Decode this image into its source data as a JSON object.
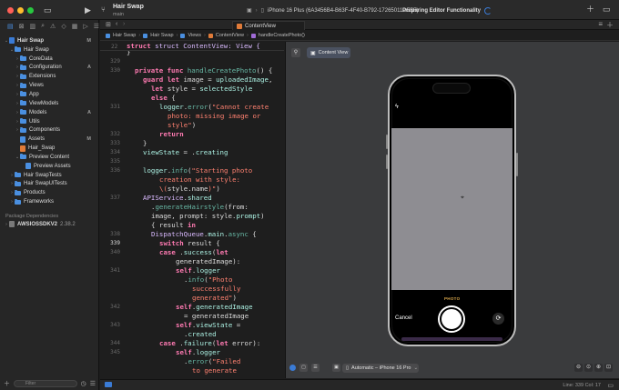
{
  "titlebar": {
    "project_name": "Hair Swap",
    "branch": "main",
    "device": "iPhone 16 Plus (6A3456B4-B63F-4F40-B792-17265011DE5F)",
    "status": "Preparing Editor Functionality",
    "colors": {
      "close": "#ff5f57",
      "minimize": "#febc2e",
      "zoom": "#28c840"
    }
  },
  "sidebar": {
    "items": [
      {
        "label": "Hair Swap",
        "badge": "M",
        "level": 0,
        "icon": "project-icon"
      },
      {
        "label": "Hair Swap",
        "badge": "",
        "level": 1,
        "icon": "folder-icon"
      },
      {
        "label": "CoreData",
        "badge": "",
        "level": 2,
        "icon": "folder-icon"
      },
      {
        "label": "Configuration",
        "badge": "A",
        "level": 2,
        "icon": "folder-icon"
      },
      {
        "label": "Extensions",
        "badge": "",
        "level": 2,
        "icon": "folder-icon"
      },
      {
        "label": "Views",
        "badge": "",
        "level": 2,
        "icon": "folder-icon"
      },
      {
        "label": "App",
        "badge": "",
        "level": 2,
        "icon": "folder-icon"
      },
      {
        "label": "ViewModels",
        "badge": "",
        "level": 2,
        "icon": "folder-icon"
      },
      {
        "label": "Models",
        "badge": "A",
        "level": 2,
        "icon": "folder-icon"
      },
      {
        "label": "Utils",
        "badge": "",
        "level": 2,
        "icon": "folder-icon"
      },
      {
        "label": "Components",
        "badge": "",
        "level": 2,
        "icon": "folder-icon"
      },
      {
        "label": "Assets",
        "badge": "M",
        "level": 2,
        "icon": "asset-icon"
      },
      {
        "label": "Hair_Swap",
        "badge": "",
        "level": 2,
        "icon": "swift-file-icon"
      },
      {
        "label": "Preview Content",
        "badge": "",
        "level": 2,
        "icon": "folder-icon"
      },
      {
        "label": "Preview Assets",
        "badge": "",
        "level": 3,
        "icon": "asset-icon"
      },
      {
        "label": "Hair SwapTests",
        "badge": "",
        "level": 1,
        "icon": "folder-icon"
      },
      {
        "label": "Hair SwapUITests",
        "badge": "",
        "level": 1,
        "icon": "folder-icon"
      },
      {
        "label": "Products",
        "badge": "",
        "level": 1,
        "icon": "folder-icon"
      },
      {
        "label": "Frameworks",
        "badge": "",
        "level": 1,
        "icon": "folder-icon"
      }
    ],
    "package_section": "Package Dependencies",
    "package": {
      "label": "AWSIOSSDKV2",
      "version": "2.38.2"
    },
    "filter_placeholder": "Filter"
  },
  "editor": {
    "tab": "ContentView",
    "breadcrumbs": [
      "Hair Swap",
      "Hair Swap",
      "Views",
      "ContentView",
      "handleCreatePhoto()"
    ],
    "sticky_line": {
      "num": "22",
      "text": "struct ContentView: View {"
    },
    "current_line": "339",
    "line_col": "Line: 339  Col: 17"
  },
  "code_lines": [
    {
      "num": "",
      "ind": 0,
      "t": [
        [
          "pl",
          "}"
        ]
      ]
    },
    {
      "num": "329",
      "ind": 0,
      "t": []
    },
    {
      "num": "330",
      "ind": 1,
      "t": [
        [
          "kw",
          "private func "
        ],
        [
          "fn",
          "handleCreatePhoto"
        ],
        [
          "pl",
          "() {"
        ]
      ]
    },
    {
      "num": "",
      "ind": 2,
      "t": [
        [
          "kw",
          "guard let "
        ],
        [
          "pl",
          "image = "
        ],
        [
          "pr",
          "uploadedImage"
        ],
        [
          "pl",
          ","
        ]
      ]
    },
    {
      "num": "",
      "ind": 3,
      "t": [
        [
          "kw",
          "let "
        ],
        [
          "pl",
          "style = "
        ],
        [
          "pr",
          "selectedStyle"
        ]
      ]
    },
    {
      "num": "",
      "ind": 3,
      "t": [
        [
          "kw",
          "else"
        ],
        [
          "pl",
          " {"
        ]
      ]
    },
    {
      "num": "331",
      "ind": 4,
      "t": [
        [
          "pr",
          "logger"
        ],
        [
          "pl",
          "."
        ],
        [
          "fn",
          "error"
        ],
        [
          "pl",
          "("
        ],
        [
          "str",
          "\"Cannot create"
        ]
      ]
    },
    {
      "num": "",
      "ind": 5,
      "t": [
        [
          "str",
          "photo: missing image or"
        ]
      ]
    },
    {
      "num": "",
      "ind": 5,
      "t": [
        [
          "str",
          "style\""
        ],
        [
          "pl",
          ")"
        ]
      ]
    },
    {
      "num": "332",
      "ind": 4,
      "t": [
        [
          "kw",
          "return"
        ]
      ]
    },
    {
      "num": "333",
      "ind": 2,
      "t": [
        [
          "pl",
          "}"
        ]
      ]
    },
    {
      "num": "334",
      "ind": 2,
      "t": [
        [
          "pr",
          "viewState"
        ],
        [
          "pl",
          " = ."
        ],
        [
          "pr",
          "creating"
        ]
      ]
    },
    {
      "num": "335",
      "ind": 0,
      "t": []
    },
    {
      "num": "336",
      "ind": 2,
      "t": [
        [
          "pr",
          "logger"
        ],
        [
          "pl",
          "."
        ],
        [
          "fn",
          "info"
        ],
        [
          "pl",
          "("
        ],
        [
          "str",
          "\"Starting photo"
        ]
      ]
    },
    {
      "num": "",
      "ind": 4,
      "t": [
        [
          "str",
          "creation with style:"
        ]
      ]
    },
    {
      "num": "",
      "ind": 4,
      "t": [
        [
          "str",
          "\\("
        ],
        [
          "pl",
          "style.name"
        ],
        [
          "str",
          ")\""
        ],
        [
          "pl",
          ")"
        ]
      ]
    },
    {
      "num": "337",
      "ind": 2,
      "t": [
        [
          "ty",
          "APIService"
        ],
        [
          "pl",
          "."
        ],
        [
          "pr",
          "shared"
        ]
      ]
    },
    {
      "num": "",
      "ind": 3,
      "t": [
        [
          "pl",
          "."
        ],
        [
          "fn",
          "generateHairstyle"
        ],
        [
          "pl",
          "(from:"
        ]
      ]
    },
    {
      "num": "",
      "ind": 3,
      "t": [
        [
          "pl",
          "image, prompt: style."
        ],
        [
          "pr",
          "prompt"
        ],
        [
          "pl",
          ")"
        ]
      ]
    },
    {
      "num": "",
      "ind": 3,
      "t": [
        [
          "pl",
          "{ result "
        ],
        [
          "kw",
          "in"
        ]
      ]
    },
    {
      "num": "338",
      "ind": 3,
      "t": [
        [
          "ty",
          "DispatchQueue"
        ],
        [
          "pl",
          "."
        ],
        [
          "pr",
          "main"
        ],
        [
          "pl",
          "."
        ],
        [
          "fn",
          "async"
        ],
        [
          "pl",
          " {"
        ]
      ]
    },
    {
      "num": "339",
      "ind": 4,
      "t": [
        [
          "kw",
          "switch "
        ],
        [
          "pl",
          "result {"
        ]
      ]
    },
    {
      "num": "340",
      "ind": 4,
      "t": [
        [
          "kw",
          "case "
        ],
        [
          "pl",
          "."
        ],
        [
          "pr",
          "success"
        ],
        [
          "pl",
          "("
        ],
        [
          "kw",
          "let"
        ]
      ]
    },
    {
      "num": "",
      "ind": 6,
      "t": [
        [
          "pl",
          "generatedImage):"
        ]
      ]
    },
    {
      "num": "341",
      "ind": 6,
      "t": [
        [
          "kw",
          "self"
        ],
        [
          "pl",
          "."
        ],
        [
          "pr",
          "logger"
        ]
      ]
    },
    {
      "num": "",
      "ind": 7,
      "t": [
        [
          "pl",
          "."
        ],
        [
          "fn",
          "info"
        ],
        [
          "pl",
          "("
        ],
        [
          "str",
          "\"Photo"
        ]
      ]
    },
    {
      "num": "",
      "ind": 8,
      "t": [
        [
          "str",
          "successfully"
        ]
      ]
    },
    {
      "num": "",
      "ind": 8,
      "t": [
        [
          "str",
          "generated\""
        ],
        [
          "pl",
          ")"
        ]
      ]
    },
    {
      "num": "342",
      "ind": 6,
      "t": [
        [
          "kw",
          "self"
        ],
        [
          "pl",
          "."
        ],
        [
          "pr",
          "generatedImage"
        ]
      ]
    },
    {
      "num": "",
      "ind": 7,
      "t": [
        [
          "pl",
          "= generatedImage"
        ]
      ]
    },
    {
      "num": "343",
      "ind": 6,
      "t": [
        [
          "kw",
          "self"
        ],
        [
          "pl",
          "."
        ],
        [
          "pr",
          "viewState"
        ],
        [
          "pl",
          " ="
        ]
      ]
    },
    {
      "num": "",
      "ind": 7,
      "t": [
        [
          "pl",
          "."
        ],
        [
          "pr",
          "created"
        ]
      ]
    },
    {
      "num": "344",
      "ind": 4,
      "t": [
        [
          "kw",
          "case "
        ],
        [
          "pl",
          "."
        ],
        [
          "pr",
          "failure"
        ],
        [
          "pl",
          "("
        ],
        [
          "kw",
          "let "
        ],
        [
          "pl",
          "error):"
        ]
      ]
    },
    {
      "num": "345",
      "ind": 6,
      "t": [
        [
          "kw",
          "self"
        ],
        [
          "pl",
          "."
        ],
        [
          "pr",
          "logger"
        ]
      ]
    },
    {
      "num": "",
      "ind": 7,
      "t": [
        [
          "pl",
          "."
        ],
        [
          "fn",
          "error"
        ],
        [
          "pl",
          "("
        ],
        [
          "str",
          "\"Failed"
        ]
      ]
    },
    {
      "num": "",
      "ind": 8,
      "t": [
        [
          "str",
          "to generate"
        ]
      ]
    }
  ],
  "preview": {
    "chip": "Content View",
    "photo_label": "PHOTO",
    "cancel": "Cancel",
    "device_selector": "Automatic – iPhone 16 Pro"
  }
}
